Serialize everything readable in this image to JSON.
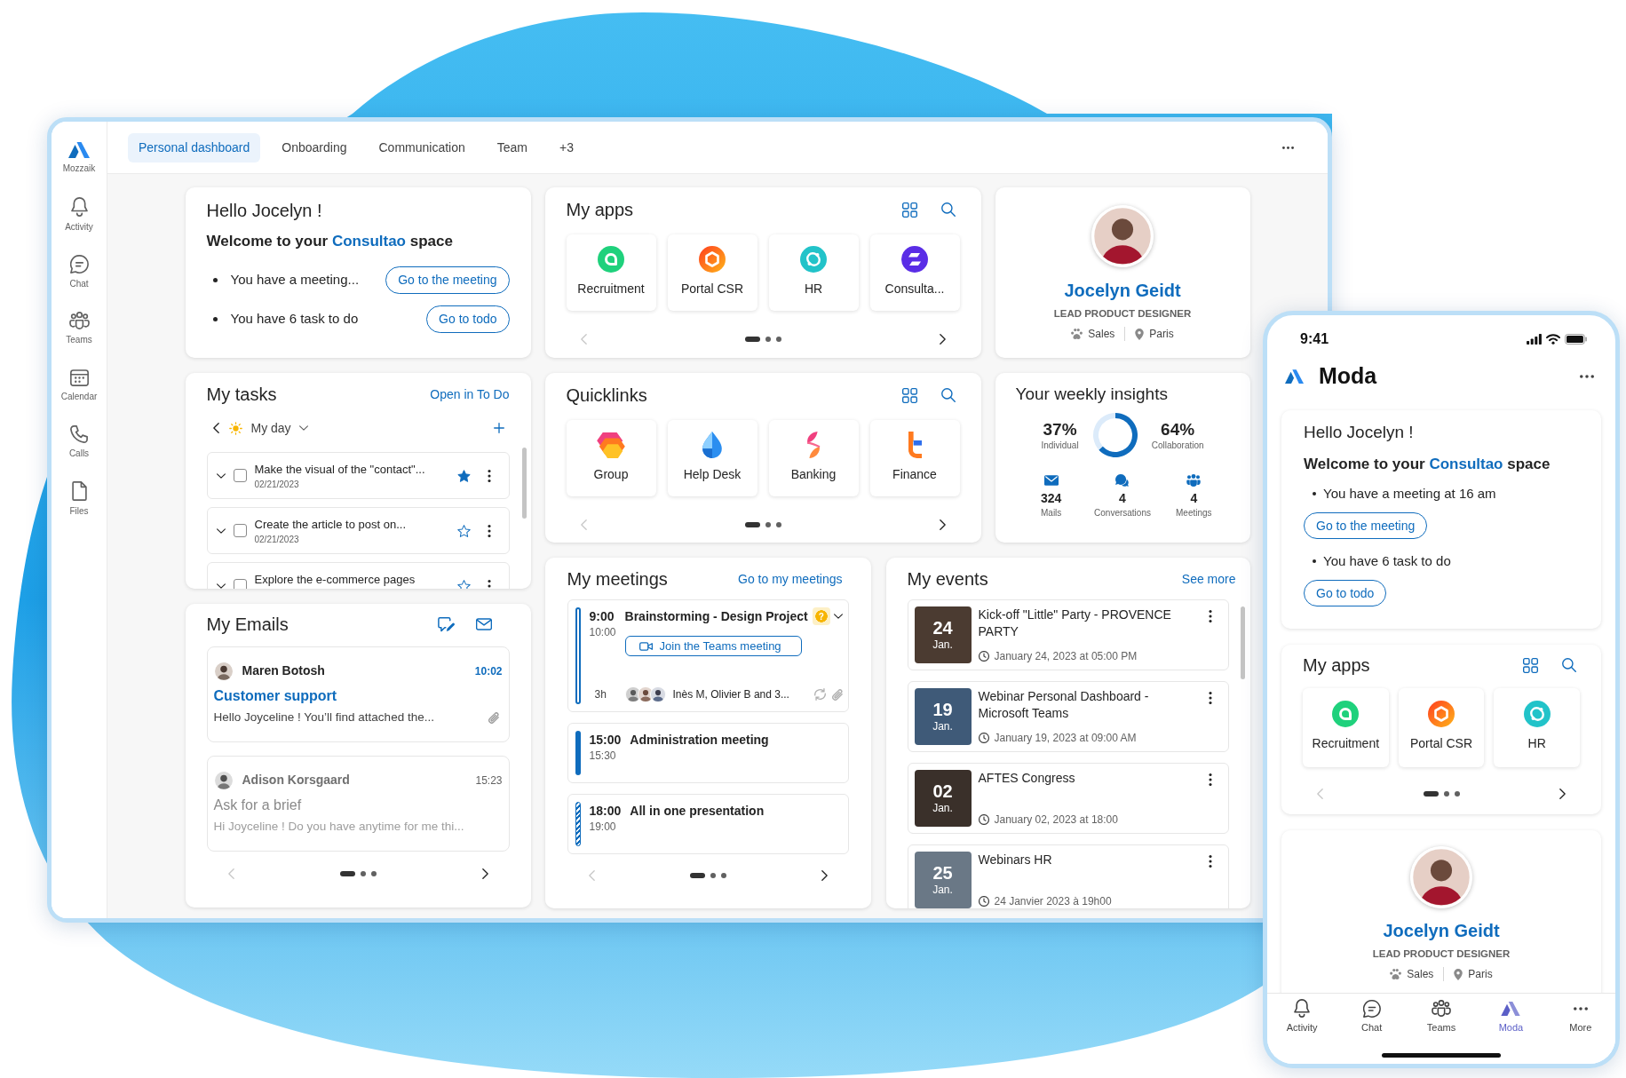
{
  "desktop": {
    "sidebar": {
      "logo_label": "Mozzaik",
      "items": [
        {
          "label": "Activity"
        },
        {
          "label": "Chat"
        },
        {
          "label": "Teams"
        },
        {
          "label": "Calendar"
        },
        {
          "label": "Calls"
        },
        {
          "label": "Files"
        }
      ]
    },
    "tabs": [
      {
        "label": "Personal dashboard",
        "selected": true
      },
      {
        "label": "Onboarding",
        "selected": false
      },
      {
        "label": "Communication",
        "selected": false
      },
      {
        "label": "Team",
        "selected": false
      },
      {
        "label": "+3",
        "selected": false
      }
    ],
    "hello_card": {
      "title": "Hello Jocelyn !",
      "welcome": {
        "before": "Welcome to your",
        "space": "Consultao",
        "after": "space"
      },
      "items": [
        {
          "text": "You have a meeting...",
          "button": "Go to the meeting"
        },
        {
          "text": "You have 6 task to do",
          "button": "Go to todo"
        }
      ]
    },
    "tasks_card": {
      "title": "My tasks",
      "link": "Open in To Do",
      "list": "My day",
      "tasks": [
        {
          "title": "Make the visual of the \"contact\"...",
          "date": "02/21/2023",
          "checked": false,
          "important": true
        },
        {
          "title": "Create the article to post on...",
          "date": "02/21/2023",
          "checked": false,
          "important": false
        },
        {
          "title": "Explore the e-commerce pages",
          "checked": false,
          "important": false
        }
      ]
    },
    "emails_card": {
      "title": "My Emails",
      "emails": [
        {
          "sender": "Maren Botosh",
          "time": "10:02",
          "subject": "Customer support",
          "preview": "Hello Joyceline ! You’ll find attached the...",
          "unread": true,
          "attachment": true
        },
        {
          "sender": "Adison Korsgaard",
          "time": "15:23",
          "subject": "Ask for a brief",
          "preview": "Hi Joyceline ! Do you have anytime for me thi...",
          "unread": false,
          "attachment": false
        }
      ],
      "pager": {
        "previous_disabled": true,
        "next_disabled": false,
        "dots": [
          {
            "selected": true
          },
          {
            "selected": false
          },
          {
            "selected": false
          }
        ]
      }
    },
    "apps_card": {
      "title": "My apps",
      "apps": [
        {
          "label": "Recruitment"
        },
        {
          "label": "Portal CSR"
        },
        {
          "label": "HR"
        },
        {
          "label": "Consulta..."
        }
      ],
      "pager": {
        "previous_disabled": true,
        "next_disabled": false,
        "dots": [
          {
            "selected": true
          },
          {
            "selected": false
          },
          {
            "selected": false
          }
        ]
      }
    },
    "quicklinks_card": {
      "title": "Quicklinks",
      "links": [
        {
          "label": "Group"
        },
        {
          "label": "Help Desk"
        },
        {
          "label": "Banking"
        },
        {
          "label": "Finance"
        }
      ],
      "pager": {
        "previous_disabled": true,
        "next_disabled": false,
        "dots": [
          {
            "selected": true
          },
          {
            "selected": false
          },
          {
            "selected": false
          }
        ]
      }
    },
    "profile_card": {
      "name": "Jocelyn Geidt",
      "job_title": "LEAD PRODUCT DESIGNER",
      "department": "Sales",
      "location": "Paris"
    },
    "insights_card": {
      "title": "Your weekly insights",
      "chart_data": {
        "type": "donut",
        "categories": [
          "Individual",
          "Collaboration"
        ],
        "values": [
          37,
          64
        ],
        "value_labels": [
          "37%",
          "64%"
        ]
      },
      "stats": [
        {
          "value": "324",
          "label": "Mails"
        },
        {
          "value": "4",
          "label": "Conversations"
        },
        {
          "value": "4",
          "label": "Meetings"
        }
      ]
    },
    "meetings_card": {
      "title": "My meetings",
      "link": "Go to my meetings",
      "meetings": [
        {
          "start": "9:00",
          "end": "10:00",
          "title": "Brainstorming - Design Project",
          "kind": "outlined",
          "expanded": true,
          "badge": "?",
          "join_button": "Join the Teams meeting",
          "duration": "3h",
          "attendees": "Inès M, Olivier B and 3...",
          "recurring": true,
          "attachment": true
        },
        {
          "start": "15:00",
          "end": "15:30",
          "title": "Administration meeting",
          "kind": "solid",
          "expanded": false
        },
        {
          "start": "18:00",
          "end": "19:00",
          "title": "All in one presentation",
          "kind": "striped",
          "expanded": false
        }
      ],
      "pager": {
        "previous_disabled": true,
        "next_disabled": false,
        "dots": [
          {
            "selected": true
          },
          {
            "selected": false
          },
          {
            "selected": false
          }
        ]
      }
    },
    "events_card": {
      "title": "My events",
      "link": "See more",
      "events": [
        {
          "day": "24",
          "month": "Jan.",
          "title": "Kick-off \"Little\" Party - PROVENCE PARTY",
          "when": "January 24, 2023 at 05:00 PM"
        },
        {
          "day": "19",
          "month": "Jan.",
          "title": "Webinar Personal Dashboard - Microsoft Teams",
          "when": "January 19, 2023 at 09:00 AM"
        },
        {
          "day": "02",
          "month": "Jan.",
          "title": "AFTES Congress",
          "when": "January 02, 2023 at 18:00"
        },
        {
          "day": "25",
          "month": "Jan.",
          "title": "Webinars HR",
          "when": "24 Janvier 2023 à 19h00"
        }
      ]
    }
  },
  "mobile": {
    "status_time": "9:41",
    "app_title": "Moda",
    "hello_card": {
      "title": "Hello Jocelyn !",
      "welcome": {
        "before": "Welcome to your",
        "space": "Consultao",
        "after": "space"
      },
      "items": [
        {
          "text": "You have a meeting at 16 am",
          "button": "Go to the meeting"
        },
        {
          "text": "You have 6 task to do",
          "button": "Go to todo"
        }
      ]
    },
    "apps_card": {
      "title": "My apps",
      "apps": [
        {
          "label": "Recruitment"
        },
        {
          "label": "Portal CSR"
        },
        {
          "label": "HR"
        }
      ],
      "pager": {
        "previous_disabled": true,
        "next_disabled": false,
        "dots": [
          {
            "selected": true
          },
          {
            "selected": false
          },
          {
            "selected": false
          }
        ]
      }
    },
    "profile_card": {
      "name": "Jocelyn Geidt",
      "job_title": "LEAD PRODUCT DESIGNER",
      "department": "Sales",
      "location": "Paris"
    },
    "nav": [
      {
        "label": "Activity",
        "selected": false
      },
      {
        "label": "Chat",
        "selected": false
      },
      {
        "label": "Teams",
        "selected": false
      },
      {
        "label": "Moda",
        "selected": true
      },
      {
        "label": "More",
        "selected": false
      }
    ]
  }
}
